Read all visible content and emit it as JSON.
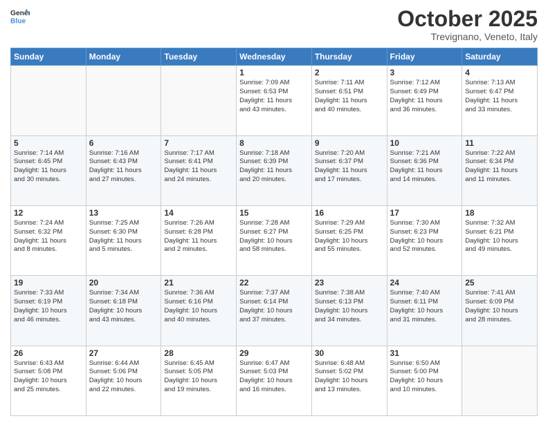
{
  "header": {
    "logo_line1": "General",
    "logo_line2": "Blue",
    "month": "October 2025",
    "location": "Trevignano, Veneto, Italy"
  },
  "weekdays": [
    "Sunday",
    "Monday",
    "Tuesday",
    "Wednesday",
    "Thursday",
    "Friday",
    "Saturday"
  ],
  "weeks": [
    [
      {
        "day": "",
        "info": ""
      },
      {
        "day": "",
        "info": ""
      },
      {
        "day": "",
        "info": ""
      },
      {
        "day": "1",
        "info": "Sunrise: 7:09 AM\nSunset: 6:53 PM\nDaylight: 11 hours\nand 43 minutes."
      },
      {
        "day": "2",
        "info": "Sunrise: 7:11 AM\nSunset: 6:51 PM\nDaylight: 11 hours\nand 40 minutes."
      },
      {
        "day": "3",
        "info": "Sunrise: 7:12 AM\nSunset: 6:49 PM\nDaylight: 11 hours\nand 36 minutes."
      },
      {
        "day": "4",
        "info": "Sunrise: 7:13 AM\nSunset: 6:47 PM\nDaylight: 11 hours\nand 33 minutes."
      }
    ],
    [
      {
        "day": "5",
        "info": "Sunrise: 7:14 AM\nSunset: 6:45 PM\nDaylight: 11 hours\nand 30 minutes."
      },
      {
        "day": "6",
        "info": "Sunrise: 7:16 AM\nSunset: 6:43 PM\nDaylight: 11 hours\nand 27 minutes."
      },
      {
        "day": "7",
        "info": "Sunrise: 7:17 AM\nSunset: 6:41 PM\nDaylight: 11 hours\nand 24 minutes."
      },
      {
        "day": "8",
        "info": "Sunrise: 7:18 AM\nSunset: 6:39 PM\nDaylight: 11 hours\nand 20 minutes."
      },
      {
        "day": "9",
        "info": "Sunrise: 7:20 AM\nSunset: 6:37 PM\nDaylight: 11 hours\nand 17 minutes."
      },
      {
        "day": "10",
        "info": "Sunrise: 7:21 AM\nSunset: 6:36 PM\nDaylight: 11 hours\nand 14 minutes."
      },
      {
        "day": "11",
        "info": "Sunrise: 7:22 AM\nSunset: 6:34 PM\nDaylight: 11 hours\nand 11 minutes."
      }
    ],
    [
      {
        "day": "12",
        "info": "Sunrise: 7:24 AM\nSunset: 6:32 PM\nDaylight: 11 hours\nand 8 minutes."
      },
      {
        "day": "13",
        "info": "Sunrise: 7:25 AM\nSunset: 6:30 PM\nDaylight: 11 hours\nand 5 minutes."
      },
      {
        "day": "14",
        "info": "Sunrise: 7:26 AM\nSunset: 6:28 PM\nDaylight: 11 hours\nand 2 minutes."
      },
      {
        "day": "15",
        "info": "Sunrise: 7:28 AM\nSunset: 6:27 PM\nDaylight: 10 hours\nand 58 minutes."
      },
      {
        "day": "16",
        "info": "Sunrise: 7:29 AM\nSunset: 6:25 PM\nDaylight: 10 hours\nand 55 minutes."
      },
      {
        "day": "17",
        "info": "Sunrise: 7:30 AM\nSunset: 6:23 PM\nDaylight: 10 hours\nand 52 minutes."
      },
      {
        "day": "18",
        "info": "Sunrise: 7:32 AM\nSunset: 6:21 PM\nDaylight: 10 hours\nand 49 minutes."
      }
    ],
    [
      {
        "day": "19",
        "info": "Sunrise: 7:33 AM\nSunset: 6:19 PM\nDaylight: 10 hours\nand 46 minutes."
      },
      {
        "day": "20",
        "info": "Sunrise: 7:34 AM\nSunset: 6:18 PM\nDaylight: 10 hours\nand 43 minutes."
      },
      {
        "day": "21",
        "info": "Sunrise: 7:36 AM\nSunset: 6:16 PM\nDaylight: 10 hours\nand 40 minutes."
      },
      {
        "day": "22",
        "info": "Sunrise: 7:37 AM\nSunset: 6:14 PM\nDaylight: 10 hours\nand 37 minutes."
      },
      {
        "day": "23",
        "info": "Sunrise: 7:38 AM\nSunset: 6:13 PM\nDaylight: 10 hours\nand 34 minutes."
      },
      {
        "day": "24",
        "info": "Sunrise: 7:40 AM\nSunset: 6:11 PM\nDaylight: 10 hours\nand 31 minutes."
      },
      {
        "day": "25",
        "info": "Sunrise: 7:41 AM\nSunset: 6:09 PM\nDaylight: 10 hours\nand 28 minutes."
      }
    ],
    [
      {
        "day": "26",
        "info": "Sunrise: 6:43 AM\nSunset: 5:08 PM\nDaylight: 10 hours\nand 25 minutes."
      },
      {
        "day": "27",
        "info": "Sunrise: 6:44 AM\nSunset: 5:06 PM\nDaylight: 10 hours\nand 22 minutes."
      },
      {
        "day": "28",
        "info": "Sunrise: 6:45 AM\nSunset: 5:05 PM\nDaylight: 10 hours\nand 19 minutes."
      },
      {
        "day": "29",
        "info": "Sunrise: 6:47 AM\nSunset: 5:03 PM\nDaylight: 10 hours\nand 16 minutes."
      },
      {
        "day": "30",
        "info": "Sunrise: 6:48 AM\nSunset: 5:02 PM\nDaylight: 10 hours\nand 13 minutes."
      },
      {
        "day": "31",
        "info": "Sunrise: 6:50 AM\nSunset: 5:00 PM\nDaylight: 10 hours\nand 10 minutes."
      },
      {
        "day": "",
        "info": ""
      }
    ]
  ]
}
